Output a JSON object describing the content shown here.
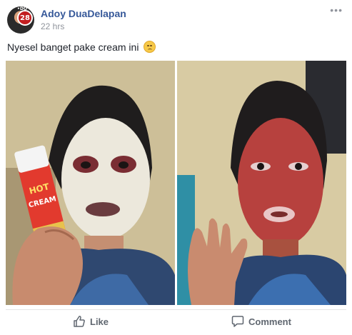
{
  "post": {
    "author": "Adoy DuaDelapan",
    "time": "22 hrs",
    "caption": "Nyesel banget pake cream ini",
    "avatar_badge": "28",
    "avatar_dots": "•DO"
  },
  "photos": {
    "left_product_text": [
      "HOT",
      "CREAM"
    ]
  },
  "actions": {
    "like": "Like",
    "comment": "Comment"
  },
  "colors": {
    "author_link": "#365899",
    "meta": "#90949c",
    "action_text": "#606770"
  }
}
